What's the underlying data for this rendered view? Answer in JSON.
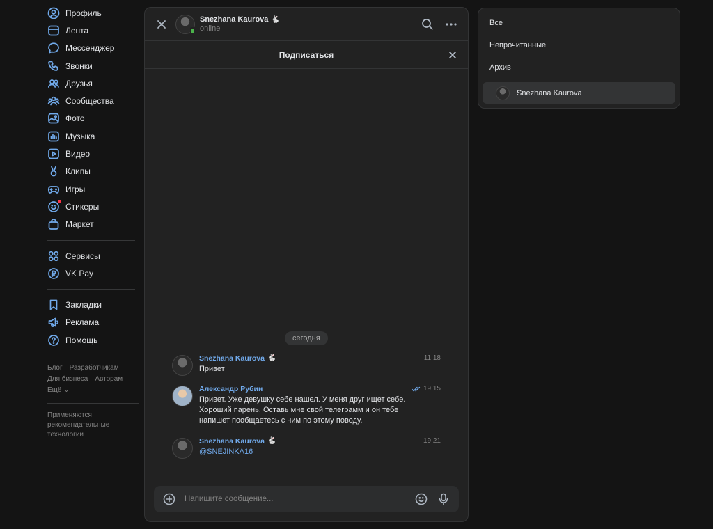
{
  "nav": {
    "main": [
      {
        "label": "Профиль",
        "icon": "user-icon"
      },
      {
        "label": "Лента",
        "icon": "feed-icon"
      },
      {
        "label": "Мессенджер",
        "icon": "message-icon"
      },
      {
        "label": "Звонки",
        "icon": "phone-icon"
      },
      {
        "label": "Друзья",
        "icon": "friends-icon"
      },
      {
        "label": "Сообщества",
        "icon": "communities-icon"
      },
      {
        "label": "Фото",
        "icon": "photo-icon"
      },
      {
        "label": "Музыка",
        "icon": "music-icon"
      },
      {
        "label": "Видео",
        "icon": "video-icon"
      },
      {
        "label": "Клипы",
        "icon": "clips-icon"
      },
      {
        "label": "Игры",
        "icon": "gamepad-icon"
      },
      {
        "label": "Стикеры",
        "icon": "sticker-icon"
      },
      {
        "label": "Маркет",
        "icon": "market-icon"
      }
    ],
    "extra": [
      {
        "label": "Сервисы",
        "icon": "services-icon"
      },
      {
        "label": "VK Pay",
        "icon": "vkpay-icon"
      }
    ],
    "tools": [
      {
        "label": "Закладки",
        "icon": "bookmark-icon"
      },
      {
        "label": "Реклама",
        "icon": "megaphone-icon"
      },
      {
        "label": "Помощь",
        "icon": "help-icon"
      }
    ],
    "footer_links": {
      "blog": "Блог",
      "developers": "Разработчикам",
      "business": "Для бизнеса",
      "authors": "Авторам",
      "more": "Ещё ⌄"
    },
    "footer_note": "Применяются рекомендательные технологии"
  },
  "chat": {
    "contact_name": "Snezhana Kaurova",
    "contact_status": "online",
    "subscribe_label": "Подписаться",
    "date_divider": "сегодня",
    "messages": [
      {
        "author": "Snezhana Kaurova",
        "time": "11:18",
        "text": "Привет"
      },
      {
        "author": "Александр Рубин",
        "time": "19:15",
        "text": "Привет. Уже девушку себе нашел. У меня друг ищет себе. Хороший парень. Оставь мне свой телеграмм и он тебе напишет пообщаетесь с ним по этому поводу."
      },
      {
        "author": "Snezhana Kaurova",
        "time": "19:21",
        "text": "@SNEJINKA16"
      }
    ],
    "composer_placeholder": "Напишите сообщение..."
  },
  "folders": {
    "items": [
      "Все",
      "Непрочитанные",
      "Архив"
    ],
    "active_chat": "Snezhana Kaurova"
  },
  "colors": {
    "accent": "#71aaeb",
    "background": "#141414",
    "panel": "#222222",
    "online": "#4bb34b",
    "notification_dot": "#ff3347"
  }
}
